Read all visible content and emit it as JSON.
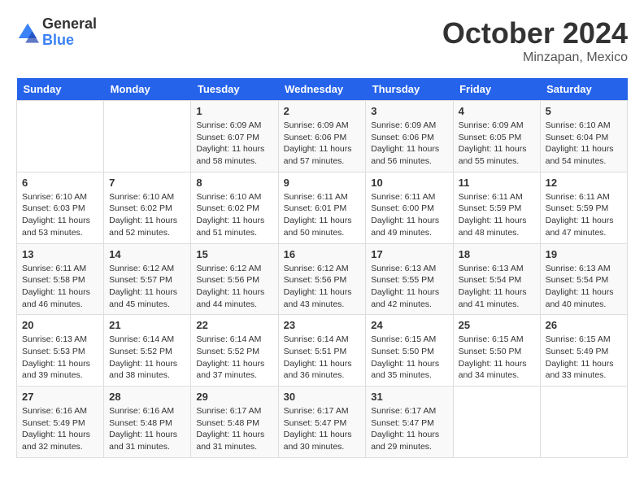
{
  "header": {
    "logo": {
      "general": "General",
      "blue": "Blue"
    },
    "title": "October 2024",
    "subtitle": "Minzapan, Mexico"
  },
  "calendar": {
    "days_of_week": [
      "Sunday",
      "Monday",
      "Tuesday",
      "Wednesday",
      "Thursday",
      "Friday",
      "Saturday"
    ],
    "weeks": [
      [
        {
          "day": "",
          "info": ""
        },
        {
          "day": "",
          "info": ""
        },
        {
          "day": "1",
          "info": "Sunrise: 6:09 AM\nSunset: 6:07 PM\nDaylight: 11 hours and 58 minutes."
        },
        {
          "day": "2",
          "info": "Sunrise: 6:09 AM\nSunset: 6:06 PM\nDaylight: 11 hours and 57 minutes."
        },
        {
          "day": "3",
          "info": "Sunrise: 6:09 AM\nSunset: 6:06 PM\nDaylight: 11 hours and 56 minutes."
        },
        {
          "day": "4",
          "info": "Sunrise: 6:09 AM\nSunset: 6:05 PM\nDaylight: 11 hours and 55 minutes."
        },
        {
          "day": "5",
          "info": "Sunrise: 6:10 AM\nSunset: 6:04 PM\nDaylight: 11 hours and 54 minutes."
        }
      ],
      [
        {
          "day": "6",
          "info": "Sunrise: 6:10 AM\nSunset: 6:03 PM\nDaylight: 11 hours and 53 minutes."
        },
        {
          "day": "7",
          "info": "Sunrise: 6:10 AM\nSunset: 6:02 PM\nDaylight: 11 hours and 52 minutes."
        },
        {
          "day": "8",
          "info": "Sunrise: 6:10 AM\nSunset: 6:02 PM\nDaylight: 11 hours and 51 minutes."
        },
        {
          "day": "9",
          "info": "Sunrise: 6:11 AM\nSunset: 6:01 PM\nDaylight: 11 hours and 50 minutes."
        },
        {
          "day": "10",
          "info": "Sunrise: 6:11 AM\nSunset: 6:00 PM\nDaylight: 11 hours and 49 minutes."
        },
        {
          "day": "11",
          "info": "Sunrise: 6:11 AM\nSunset: 5:59 PM\nDaylight: 11 hours and 48 minutes."
        },
        {
          "day": "12",
          "info": "Sunrise: 6:11 AM\nSunset: 5:59 PM\nDaylight: 11 hours and 47 minutes."
        }
      ],
      [
        {
          "day": "13",
          "info": "Sunrise: 6:11 AM\nSunset: 5:58 PM\nDaylight: 11 hours and 46 minutes."
        },
        {
          "day": "14",
          "info": "Sunrise: 6:12 AM\nSunset: 5:57 PM\nDaylight: 11 hours and 45 minutes."
        },
        {
          "day": "15",
          "info": "Sunrise: 6:12 AM\nSunset: 5:56 PM\nDaylight: 11 hours and 44 minutes."
        },
        {
          "day": "16",
          "info": "Sunrise: 6:12 AM\nSunset: 5:56 PM\nDaylight: 11 hours and 43 minutes."
        },
        {
          "day": "17",
          "info": "Sunrise: 6:13 AM\nSunset: 5:55 PM\nDaylight: 11 hours and 42 minutes."
        },
        {
          "day": "18",
          "info": "Sunrise: 6:13 AM\nSunset: 5:54 PM\nDaylight: 11 hours and 41 minutes."
        },
        {
          "day": "19",
          "info": "Sunrise: 6:13 AM\nSunset: 5:54 PM\nDaylight: 11 hours and 40 minutes."
        }
      ],
      [
        {
          "day": "20",
          "info": "Sunrise: 6:13 AM\nSunset: 5:53 PM\nDaylight: 11 hours and 39 minutes."
        },
        {
          "day": "21",
          "info": "Sunrise: 6:14 AM\nSunset: 5:52 PM\nDaylight: 11 hours and 38 minutes."
        },
        {
          "day": "22",
          "info": "Sunrise: 6:14 AM\nSunset: 5:52 PM\nDaylight: 11 hours and 37 minutes."
        },
        {
          "day": "23",
          "info": "Sunrise: 6:14 AM\nSunset: 5:51 PM\nDaylight: 11 hours and 36 minutes."
        },
        {
          "day": "24",
          "info": "Sunrise: 6:15 AM\nSunset: 5:50 PM\nDaylight: 11 hours and 35 minutes."
        },
        {
          "day": "25",
          "info": "Sunrise: 6:15 AM\nSunset: 5:50 PM\nDaylight: 11 hours and 34 minutes."
        },
        {
          "day": "26",
          "info": "Sunrise: 6:15 AM\nSunset: 5:49 PM\nDaylight: 11 hours and 33 minutes."
        }
      ],
      [
        {
          "day": "27",
          "info": "Sunrise: 6:16 AM\nSunset: 5:49 PM\nDaylight: 11 hours and 32 minutes."
        },
        {
          "day": "28",
          "info": "Sunrise: 6:16 AM\nSunset: 5:48 PM\nDaylight: 11 hours and 31 minutes."
        },
        {
          "day": "29",
          "info": "Sunrise: 6:17 AM\nSunset: 5:48 PM\nDaylight: 11 hours and 31 minutes."
        },
        {
          "day": "30",
          "info": "Sunrise: 6:17 AM\nSunset: 5:47 PM\nDaylight: 11 hours and 30 minutes."
        },
        {
          "day": "31",
          "info": "Sunrise: 6:17 AM\nSunset: 5:47 PM\nDaylight: 11 hours and 29 minutes."
        },
        {
          "day": "",
          "info": ""
        },
        {
          "day": "",
          "info": ""
        }
      ]
    ]
  }
}
